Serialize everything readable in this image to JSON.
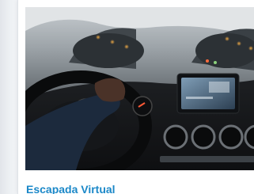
{
  "card": {
    "title": "Escapada Virtual",
    "image_icon": "car-dashboard-photo",
    "title_color": "#1b88c8"
  }
}
